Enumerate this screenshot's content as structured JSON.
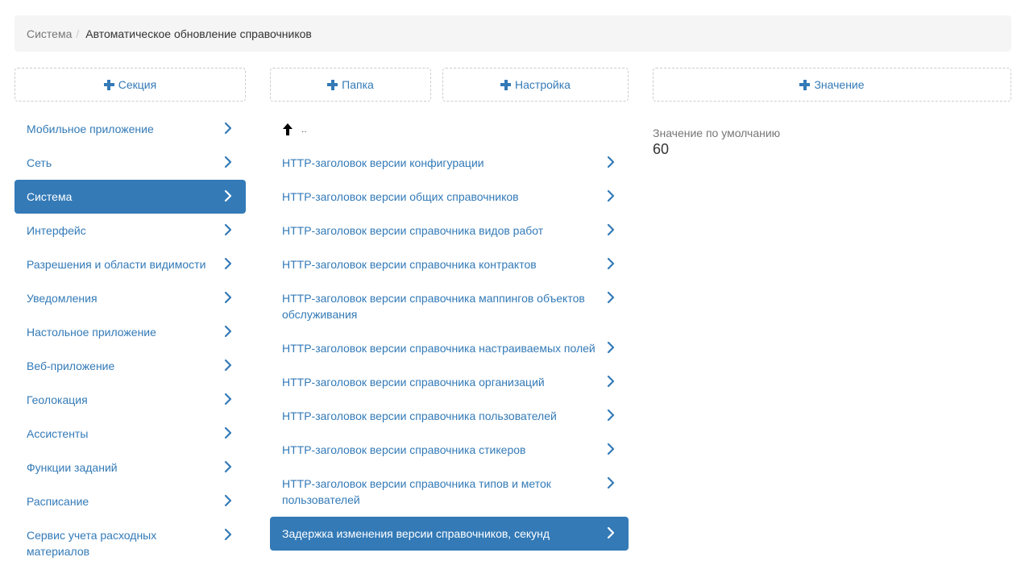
{
  "breadcrumb": {
    "parent": "Система",
    "separator": "/",
    "current": "Автоматическое обновление справочников"
  },
  "buttons": {
    "add_section": "Секция",
    "add_folder": "Папка",
    "add_setting": "Настройка",
    "add_value": "Значение"
  },
  "sections": {
    "items": [
      {
        "label": "Мобильное приложение"
      },
      {
        "label": "Сеть"
      },
      {
        "label": "Система"
      },
      {
        "label": "Интерфейс"
      },
      {
        "label": "Разрешения и области видимости"
      },
      {
        "label": "Уведомления"
      },
      {
        "label": "Настольное приложение"
      },
      {
        "label": "Веб-приложение"
      },
      {
        "label": "Геолокация"
      },
      {
        "label": "Ассистенты"
      },
      {
        "label": "Функции заданий"
      },
      {
        "label": "Расписание"
      },
      {
        "label": "Сервис учета расходных материалов"
      }
    ],
    "active_index": 2
  },
  "settings": {
    "up_label": "..",
    "items": [
      {
        "label": "HTTP-заголовок версии конфигурации"
      },
      {
        "label": "HTTP-заголовок версии общих справочников"
      },
      {
        "label": "HTTP-заголовок версии справочника видов работ"
      },
      {
        "label": "HTTP-заголовок версии справочника контрактов"
      },
      {
        "label": "HTTP-заголовок версии справочника маппингов объектов обслуживания"
      },
      {
        "label": "HTTP-заголовок версии справочника настраиваемых полей"
      },
      {
        "label": "HTTP-заголовок версии справочника организаций"
      },
      {
        "label": "HTTP-заголовок версии справочника пользователей"
      },
      {
        "label": "HTTP-заголовок версии справочника стикеров"
      },
      {
        "label": "HTTP-заголовок версии справочника типов и меток пользователей"
      },
      {
        "label": "Задержка изменения версии справочников, секунд"
      }
    ],
    "active_index": 10
  },
  "value": {
    "label": "Значение по умолчанию",
    "value": "60"
  },
  "colors": {
    "accent": "#337ab7",
    "breadcrumb_bg": "#f5f5f5",
    "muted_text": "#777777"
  }
}
